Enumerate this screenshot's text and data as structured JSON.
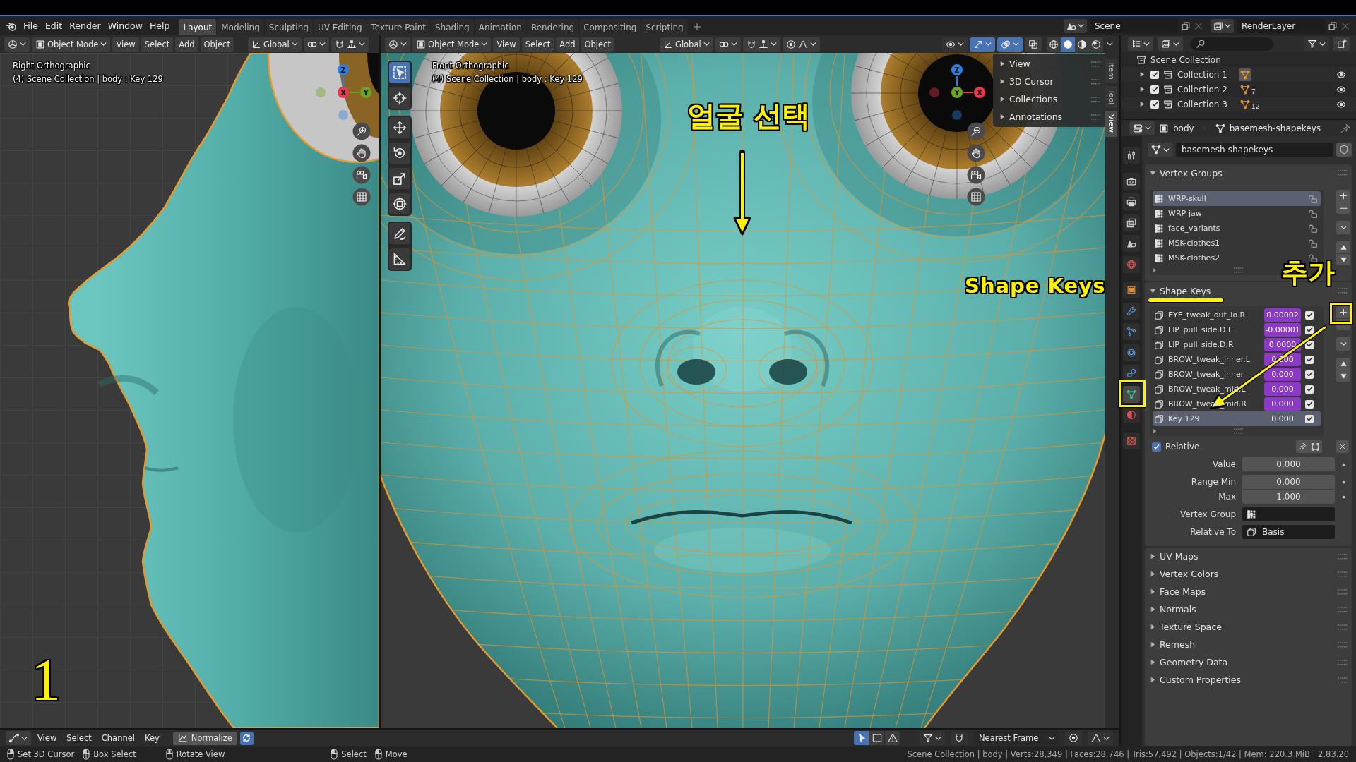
{
  "top_bar": {
    "menus": [
      "File",
      "Edit",
      "Render",
      "Window",
      "Help"
    ],
    "workspaces": [
      {
        "label": "Layout",
        "selected": true
      },
      {
        "label": "Modeling",
        "selected": false
      },
      {
        "label": "Sculpting",
        "selected": false
      },
      {
        "label": "UV Editing",
        "selected": false
      },
      {
        "label": "Texture Paint",
        "selected": false
      },
      {
        "label": "Shading",
        "selected": false
      },
      {
        "label": "Animation",
        "selected": false
      },
      {
        "label": "Rendering",
        "selected": false
      },
      {
        "label": "Compositing",
        "selected": false
      },
      {
        "label": "Scripting",
        "selected": false
      }
    ],
    "scene": "Scene",
    "view_layer": "RenderLayer"
  },
  "viewports": [
    {
      "kind": "side",
      "mode": "Object Mode",
      "menus": [
        "View",
        "Select",
        "Add",
        "Object"
      ],
      "orientation": "Global",
      "view_name": "Right Orthographic",
      "info": "(4) Scene Collection | body : Key 129",
      "gizmo_axes": [
        {
          "label": "Z",
          "color": "#2f7fe0"
        },
        {
          "label": "X",
          "color": "#e8384f"
        },
        {
          "label": "Y",
          "color": "#6ea51e"
        }
      ]
    },
    {
      "kind": "front",
      "mode": "Object Mode",
      "menus": [
        "View",
        "Select",
        "Add",
        "Object"
      ],
      "orientation": "Global",
      "view_name": "Front Orthographic",
      "info": "(4) Scene Collection | body : Key 129",
      "gizmo_axes": [
        {
          "label": "Z",
          "color": "#2f7fe0"
        },
        {
          "label": "Y",
          "color": "#6ea51e"
        },
        {
          "label": "X",
          "color": "#e8384f"
        }
      ],
      "toggles": [
        {
          "kind": "gizmo",
          "on": true
        },
        {
          "kind": "overlay",
          "on": true
        },
        {
          "kind": "xray",
          "on": false
        }
      ],
      "shading": [
        {
          "kind": "wireframe",
          "selected": false
        },
        {
          "kind": "solid",
          "selected": true
        },
        {
          "kind": "material",
          "selected": false
        },
        {
          "kind": "rendered",
          "selected": false
        }
      ],
      "toolbar": [
        [
          {
            "kind": "select_box",
            "selected": true
          },
          {
            "kind": "cursor",
            "selected": false
          }
        ],
        [
          {
            "kind": "move",
            "selected": false
          },
          {
            "kind": "rotate",
            "selected": false
          },
          {
            "kind": "scale",
            "selected": false
          },
          {
            "kind": "transform",
            "selected": false
          }
        ],
        [
          {
            "kind": "annotate",
            "selected": false
          },
          {
            "kind": "measure",
            "selected": false
          }
        ]
      ],
      "sidebar": {
        "panels": [
          {
            "title": "View",
            "expanded": false
          },
          {
            "title": "3D Cursor",
            "expanded": false
          },
          {
            "title": "Collections",
            "expanded": false
          },
          {
            "title": "Annotations",
            "expanded": false
          }
        ],
        "tabs": [
          {
            "label": "Item",
            "selected": false
          },
          {
            "label": "Tool",
            "selected": false
          },
          {
            "label": "View",
            "selected": true
          }
        ]
      }
    }
  ],
  "outliner": {
    "root": "Scene Collection",
    "collections": [
      {
        "name": "Collection 1",
        "expanded": false,
        "checked": true,
        "highlighted": true,
        "visible": true
      },
      {
        "name": "Collection 2",
        "expanded": false,
        "checked": true,
        "highlighted": false,
        "count": "7",
        "visible": true
      },
      {
        "name": "Collection 3",
        "expanded": false,
        "checked": true,
        "highlighted": false,
        "count": "12",
        "visible": true
      }
    ]
  },
  "properties": {
    "object": "body",
    "data": "basemesh-shapekeys",
    "datablock": "basemesh-shapekeys",
    "tabs": [
      {
        "kind": "tool",
        "selected": false
      },
      {
        "kind": "render",
        "selected": false
      },
      {
        "kind": "output",
        "selected": false
      },
      {
        "kind": "view_layer",
        "selected": false
      },
      {
        "kind": "scene",
        "selected": false
      },
      {
        "kind": "world",
        "selected": false
      },
      {
        "kind": "object",
        "selected": false
      },
      {
        "kind": "modifiers",
        "selected": false
      },
      {
        "kind": "particles",
        "selected": false
      },
      {
        "kind": "physics",
        "selected": false
      },
      {
        "kind": "constraints",
        "selected": false
      },
      {
        "kind": "data",
        "selected": true
      },
      {
        "kind": "material",
        "selected": false
      },
      {
        "kind": "texture",
        "selected": false
      }
    ],
    "vertex_groups": {
      "title": "Vertex Groups",
      "expanded": true,
      "items": [
        {
          "name": "WRP-skull",
          "selected": true,
          "locked": false
        },
        {
          "name": "WRP-jaw",
          "selected": false,
          "locked": false
        },
        {
          "name": "face_variants",
          "selected": false,
          "locked": false
        },
        {
          "name": "MSK-clothes1",
          "selected": false,
          "locked": false
        },
        {
          "name": "MSK-clothes2",
          "selected": false,
          "locked": false
        }
      ]
    },
    "shape_keys": {
      "title": "Shape Keys",
      "expanded": true,
      "items": [
        {
          "name": "EYE_tweak_out_lo.R",
          "value": "0.00002",
          "driven": true,
          "checked": true,
          "selected": false
        },
        {
          "name": "LIP_pull_side.D.L",
          "value": "-0.00001",
          "driven": true,
          "checked": true,
          "selected": false
        },
        {
          "name": "LIP_pull_side.D.R",
          "value": "0.0000",
          "driven": true,
          "checked": true,
          "selected": false
        },
        {
          "name": "BROW_tweak_inner.L",
          "value": "0.000",
          "driven": true,
          "checked": true,
          "selected": false
        },
        {
          "name": "BROW_tweak_inner",
          "value": "0.000",
          "driven": true,
          "checked": true,
          "selected": false
        },
        {
          "name": "BROW_tweak_mid.L",
          "value": "0.000",
          "driven": true,
          "checked": true,
          "selected": false
        },
        {
          "name": "BROW_tweak_mid.R",
          "value": "0.000",
          "driven": true,
          "checked": true,
          "selected": false
        },
        {
          "name": "Key 129",
          "value": "0.000",
          "driven": false,
          "checked": true,
          "selected": true
        }
      ],
      "relative": {
        "label": "Relative",
        "checked": true
      },
      "fields": [
        {
          "kind": "number",
          "label": "Value",
          "value": "0.000"
        },
        {
          "kind": "number",
          "label": "Range Min",
          "value": "0.000"
        },
        {
          "kind": "number",
          "label": "Max",
          "value": "1.000"
        },
        {
          "kind": "vertex_group",
          "label": "Vertex Group"
        },
        {
          "kind": "shape_key",
          "label": "Relative To",
          "value": "Basis"
        }
      ]
    },
    "sections": [
      {
        "title": "UV Maps",
        "expanded": false
      },
      {
        "title": "Vertex Colors",
        "expanded": false
      },
      {
        "title": "Face Maps",
        "expanded": false
      },
      {
        "title": "Normals",
        "expanded": false
      },
      {
        "title": "Texture Space",
        "expanded": false
      },
      {
        "title": "Remesh",
        "expanded": false
      },
      {
        "title": "Geometry Data",
        "expanded": false
      },
      {
        "title": "Custom Properties",
        "expanded": false
      }
    ]
  },
  "timeline": {
    "menus": [
      "View",
      "Select",
      "Channel",
      "Key"
    ],
    "normalize": {
      "label": "Normalize",
      "on": false
    },
    "refresh_toggle": {
      "on": true
    },
    "filters": [
      {
        "kind": "only_selected",
        "on": true
      },
      {
        "kind": "show_hidden",
        "on": false
      },
      {
        "kind": "only_errors",
        "on": false
      }
    ],
    "snap_mode": "Nearest Frame"
  },
  "status_bar": {
    "hints": [
      {
        "kind": "right",
        "label": "Set 3D Cursor"
      },
      {
        "kind": "drag",
        "label": "Box Select"
      },
      {
        "kind": "middle",
        "label": "Rotate View"
      },
      {
        "kind": "left",
        "label": "Select"
      },
      {
        "kind": "drag",
        "label": "Move"
      }
    ],
    "stats": "Scene Collection | body | Verts:28,349 | Faces:28,746 | Tris:57,492 | Objects:1/42 | Mem: 220.3 MiB | 2.83.20"
  },
  "annotations": [
    {
      "text": "얼굴 선택"
    },
    {
      "text": "Shape Keys"
    },
    {
      "text": "추가"
    },
    {
      "text": "1"
    }
  ]
}
